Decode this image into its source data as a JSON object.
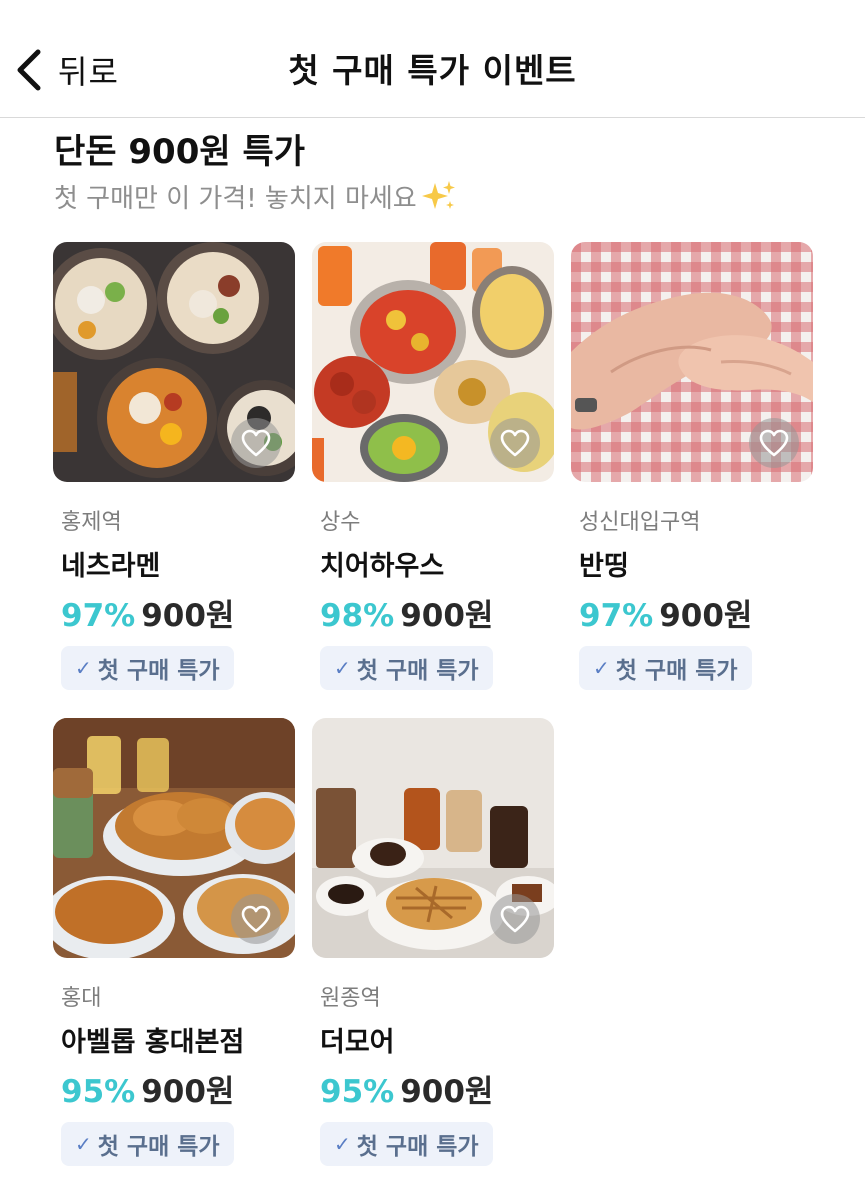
{
  "header": {
    "back_label": "뒤로",
    "title": "첫 구매 특가 이벤트"
  },
  "section": {
    "title": "단돈 900원 특가",
    "subtitle": "첫 구매만 이 가격! 놓치지 마세요"
  },
  "products": [
    {
      "location": "홍제역",
      "name": "네츠라멘",
      "discount": "97%",
      "price": "900원",
      "badge": "첫 구매 특가",
      "image": "ramen-bowls-photo"
    },
    {
      "location": "상수",
      "name": "치어하우스",
      "discount": "98%",
      "price": "900원",
      "badge": "첫 구매 특가",
      "image": "pub-food-spread-photo"
    },
    {
      "location": "성신대입구역",
      "name": "반띵",
      "discount": "97%",
      "price": "900원",
      "badge": "첫 구매 특가",
      "image": "holding-hands-photo"
    },
    {
      "location": "홍대",
      "name": "아벨롭 홍대본점",
      "discount": "95%",
      "price": "900원",
      "badge": "첫 구매 특가",
      "image": "croissant-bakery-photo"
    },
    {
      "location": "원종역",
      "name": "더모어",
      "discount": "95%",
      "price": "900원",
      "badge": "첫 구매 특가",
      "image": "croffle-cafe-photo"
    }
  ],
  "colors": {
    "discount": "#3cc7cf",
    "badge_bg": "#eef2fa",
    "badge_text": "#5a6f8e",
    "divider": "#d9d9d9"
  },
  "icons": [
    "chevron-left-icon",
    "sparkle-icon",
    "heart-icon",
    "check-icon"
  ]
}
